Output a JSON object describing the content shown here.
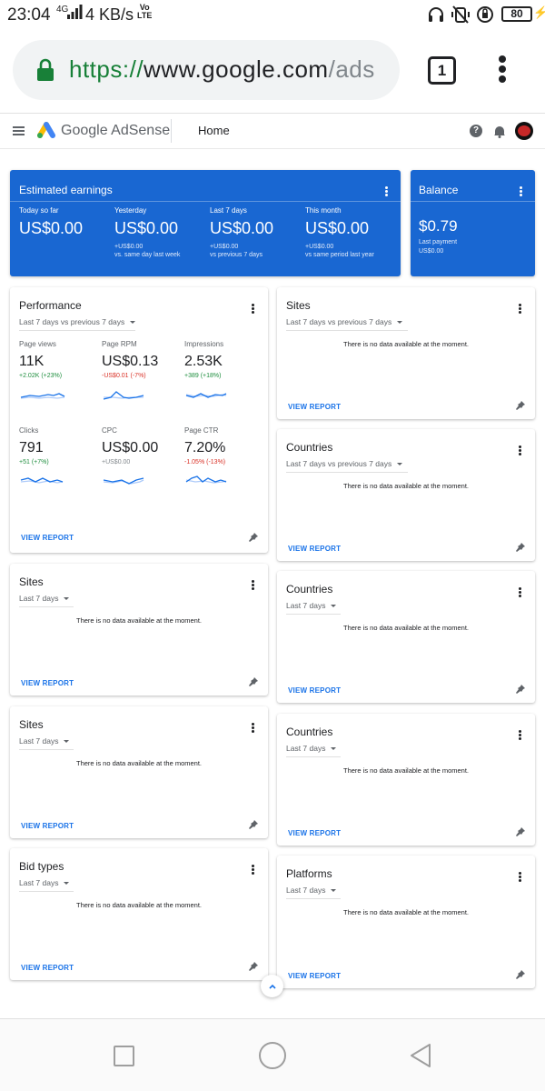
{
  "status_bar": {
    "time": "23:04",
    "network": "4G",
    "speed": "4 KB/s",
    "volte_top": "Vo",
    "volte_bottom": "LTE",
    "battery": "80",
    "icons": [
      "headset-icon",
      "vibrate-off-icon",
      "data-saver-icon"
    ]
  },
  "browser": {
    "url_scheme": "https://",
    "url_domain": "www.google.com",
    "url_path": "/ads",
    "tab_count": "1"
  },
  "app": {
    "brand": "Google AdSense",
    "nav_home": "Home",
    "help": "?"
  },
  "earnings": {
    "title": "Estimated earnings",
    "columns": [
      {
        "label": "Today so far",
        "value": "US$0.00",
        "sub1": "",
        "sub2": ""
      },
      {
        "label": "Yesterday",
        "value": "US$0.00",
        "sub1": "+US$0.00",
        "sub2": "vs. same day last week"
      },
      {
        "label": "Last 7 days",
        "value": "US$0.00",
        "sub1": "+US$0.00",
        "sub2": "vs previous 7 days"
      },
      {
        "label": "This month",
        "value": "US$0.00",
        "sub1": "+US$0.00",
        "sub2": "vs same period last year"
      }
    ]
  },
  "balance": {
    "title": "Balance",
    "value": "$0.79",
    "sub1": "Last payment",
    "sub2": "US$0.00"
  },
  "performance": {
    "title": "Performance",
    "period": "Last 7 days vs previous 7 days",
    "metrics": [
      {
        "label": "Page views",
        "value": "11K",
        "delta": "+2.02K (+23%)",
        "trend": "up"
      },
      {
        "label": "Page RPM",
        "value": "US$0.13",
        "delta": "-US$0.01 (-7%)",
        "trend": "down"
      },
      {
        "label": "Impressions",
        "value": "2.53K",
        "delta": "+389 (+18%)",
        "trend": "up"
      },
      {
        "label": "Clicks",
        "value": "791",
        "delta": "+51 (+7%)",
        "trend": "up"
      },
      {
        "label": "CPC",
        "value": "US$0.00",
        "delta": "+US$0.00",
        "trend": "neutral"
      },
      {
        "label": "Page CTR",
        "value": "7.20%",
        "delta": "-1.05% (-13%)",
        "trend": "down"
      }
    ],
    "view_report": "VIEW REPORT"
  },
  "left_cards": [
    {
      "title": "Sites",
      "period": "Last 7 days",
      "message": "There is no data available at the moment.",
      "view_report": "VIEW REPORT"
    },
    {
      "title": "Sites",
      "period": "Last 7 days",
      "message": "There is no data available at the moment.",
      "view_report": "VIEW REPORT"
    },
    {
      "title": "Bid types",
      "period": "Last 7 days",
      "message": "There is no data available at the moment.",
      "view_report": "VIEW REPORT"
    }
  ],
  "right_cards": [
    {
      "title": "Sites",
      "period": "Last 7 days vs previous 7 days",
      "message": "There is no data available at the moment.",
      "view_report": "VIEW REPORT"
    },
    {
      "title": "Countries",
      "period": "Last 7 days vs previous 7 days",
      "message": "There is no data available at the moment.",
      "view_report": "VIEW REPORT"
    },
    {
      "title": "Countries",
      "period": "Last 7 days",
      "message": "There is no data available at the moment.",
      "view_report": "VIEW REPORT"
    },
    {
      "title": "Countries",
      "period": "Last 7 days",
      "message": "There is no data available at the moment.",
      "view_report": "VIEW REPORT"
    },
    {
      "title": "Platforms",
      "period": "Last 7 days",
      "message": "There is no data available at the moment.",
      "view_report": "VIEW REPORT"
    }
  ],
  "colors": {
    "accent_blue": "#1967d2",
    "link_blue": "#1a73e8",
    "positive": "#1e8e3e",
    "negative": "#d93025"
  }
}
